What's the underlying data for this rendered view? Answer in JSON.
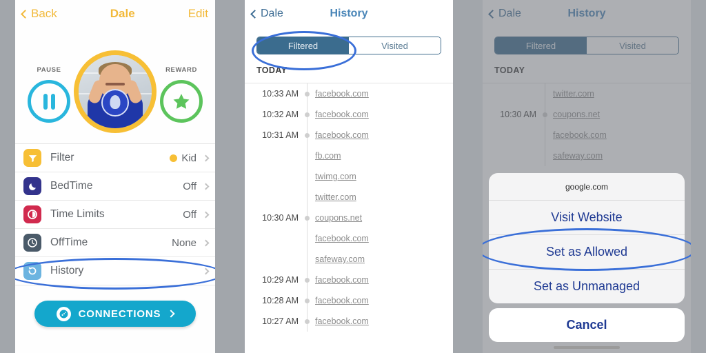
{
  "colors": {
    "accent_yellow": "#f2b93a",
    "avatar_ring": "#f7bf35",
    "pause_cyan": "#29b6dd",
    "reward_green": "#5cc45c",
    "connections_teal": "#14a7cc",
    "tab_active": "#3b6c8e",
    "highlight_ellipse": "#3a6fd8",
    "sheet_text": "#1f3a93",
    "gutter_gray": "#a2a6ab"
  },
  "profile_screen": {
    "nav": {
      "back_label": "Back",
      "back_icon": "chevron-left-icon",
      "title": "Dale",
      "edit_label": "Edit"
    },
    "pause": {
      "label": "PAUSE",
      "icon": "pause-icon"
    },
    "reward": {
      "label": "REWARD",
      "icon": "star-icon"
    },
    "avatar": {
      "icon": "avatar-photo"
    },
    "settings": [
      {
        "label": "Filter",
        "value": "Kid",
        "has_dot": true,
        "icon": "filter-icon",
        "icon_bg": "#f7bf35"
      },
      {
        "label": "BedTime",
        "value": "Off",
        "has_dot": false,
        "icon": "moon-icon",
        "icon_bg": "#33338c"
      },
      {
        "label": "Time Limits",
        "value": "Off",
        "has_dot": false,
        "icon": "timer-icon",
        "icon_bg": "#d12a4e"
      },
      {
        "label": "OffTime",
        "value": "None",
        "has_dot": false,
        "icon": "clock-icon",
        "icon_bg": "#4a5a69"
      },
      {
        "label": "History",
        "value": "",
        "has_dot": false,
        "icon": "history-icon",
        "icon_bg": "#6cb4e0"
      }
    ],
    "connections": {
      "label": "CONNECTIONS",
      "icon": "connections-icon",
      "chevron": "chevron-right-icon"
    }
  },
  "history_screen": {
    "nav": {
      "back_label": "Dale",
      "back_icon": "chevron-left-icon",
      "title": "History"
    },
    "tabs": {
      "filtered": "Filtered",
      "visited": "Visited",
      "active": "Filtered"
    },
    "section_header": "TODAY",
    "entries": [
      {
        "time": "10:33 AM",
        "sites": [
          "facebook.com"
        ]
      },
      {
        "time": "10:32 AM",
        "sites": [
          "facebook.com"
        ]
      },
      {
        "time": "10:31 AM",
        "sites": [
          "facebook.com",
          "fb.com",
          "twimg.com",
          "twitter.com"
        ]
      },
      {
        "time": "10:30 AM",
        "sites": [
          "coupons.net",
          "facebook.com",
          "safeway.com"
        ]
      },
      {
        "time": "10:29 AM",
        "sites": [
          "facebook.com"
        ]
      },
      {
        "time": "10:28 AM",
        "sites": [
          "facebook.com"
        ]
      },
      {
        "time": "10:27 AM",
        "sites": [
          "facebook.com"
        ]
      }
    ]
  },
  "action_sheet_screen": {
    "nav": {
      "back_label": "Dale",
      "back_icon": "chevron-left-icon",
      "title": "History"
    },
    "tabs": {
      "filtered": "Filtered",
      "visited": "Visited",
      "active": "Filtered"
    },
    "section_header": "TODAY",
    "entries": [
      {
        "time": "",
        "sites": [
          "twitter.com"
        ]
      },
      {
        "time": "10:30 AM",
        "sites": [
          "coupons.net",
          "facebook.com",
          "safeway.com"
        ]
      }
    ],
    "sheet": {
      "title": "google.com",
      "options": [
        "Visit Website",
        "Set as Allowed",
        "Set as Unmanaged"
      ],
      "cancel": "Cancel"
    }
  }
}
